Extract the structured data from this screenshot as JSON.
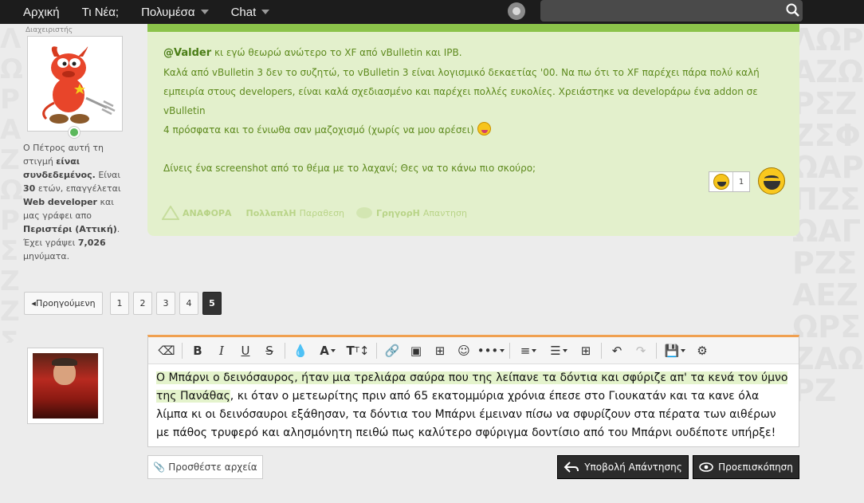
{
  "nav": {
    "items": [
      {
        "label": "Αρχική",
        "dropdown": false
      },
      {
        "label": "Τι Νέα;",
        "dropdown": false
      },
      {
        "label": "Πολυμέσα",
        "dropdown": true
      },
      {
        "label": "Chat",
        "dropdown": true
      }
    ],
    "search_placeholder": ""
  },
  "user_card": {
    "rank": "Διαχειριστής",
    "desc_1": "Ο Πέτρος αυτή τη στιγμή",
    "online_status": "είναι συνδεδεμένος.",
    "desc_2": "Είναι",
    "age": "30",
    "desc_3": "ετών, επαγγέλεται",
    "profession": "Web developer",
    "desc_4": "και μας γράφει απο",
    "location": "Περιστέρι (Αττική)",
    "desc_5": ". Έχει γράψει",
    "post_count": "7,026",
    "desc_6": "μηνύματα."
  },
  "post": {
    "mention": "@Valder",
    "line1": " κι εγώ θεωρώ ανώτερο το XF από vBulletin και IPB.",
    "line2": "Καλά από vBulletin 3 δεν το συζητώ, το vBulletin 3 είναι λογισμικό δεκαετίας '00. Να πω ότι το XF παρέχει πάρα πολύ καλή",
    "line3": "εμπειρία στους developers, είναι καλά σχεδιασμένο και παρέχει πολλές ευκολίες. Χρειάστηκε να developάρω ένα addon σε vBulletin",
    "line4": "4 πρόσφατα και το ένιωθα σαν μαζοχισμό (χωρίς να μου αρέσει)",
    "line5": "Δίνεις ένα screenshot από το θέμα με το λαχανί; Θες να το κάνω πιο σκούρο;",
    "reaction_count": "1",
    "actions": [
      {
        "bold": "ΑΝΑΦΟΡΑ",
        "rest": ""
      },
      {
        "bold": "ΠολλαπλΗ",
        "rest": "Παραθεση"
      },
      {
        "bold": "ΓρηγορΗ",
        "rest": "Απαντηση"
      }
    ]
  },
  "pagination": {
    "prev": "Προηγούμενη",
    "pages": [
      "1",
      "2",
      "3",
      "4",
      "5"
    ],
    "current": "5"
  },
  "editor": {
    "hl_text": "Ο Μπάρνι ο δεινόσαυρος, ήταν μια τρελιάρα σαύρα που της λείπανε τα δόντια και σφύριζε απ' τα κενά τον ύμνο της Πανάθας",
    "rest_text": ", κι όταν ο μετεωρίτης πριν από 65 εκατομμύρια χρόνια έπεσε στο Γιουκατάν και τα κανε όλα λίμπα κι οι δεινόσαυροι εξάθησαν, τα δόντια του Μπάρνι έμειναν πίσω να σφυρίζουν στα πέρατα των αιθέρων με πάθος τρυφερό και αλησμόνητη πειθώ πως καλύτερο σφύριγμα δοντίσιο από του Μπάρνι ουδέποτε υπήρξε!"
  },
  "buttons": {
    "attach": "Προσθέστε αρχεία",
    "submit": "Υποβολή Απάντησης",
    "preview": "Προεπισκόπηση"
  },
  "colors": {
    "accent": "#8bc34a",
    "post_bg": "#e3f0cc",
    "post_text": "#5e8a1e",
    "editor_border": "#f0a050",
    "nav_bg": "#1c1c1c"
  },
  "watermark": "ΛΩΡΑΖΩΡΣΖΖΣΦΩΑΡΠΖΣΩΑΓΡΖΣΑΕΖΩΡΣΖΑΩΡΖ"
}
